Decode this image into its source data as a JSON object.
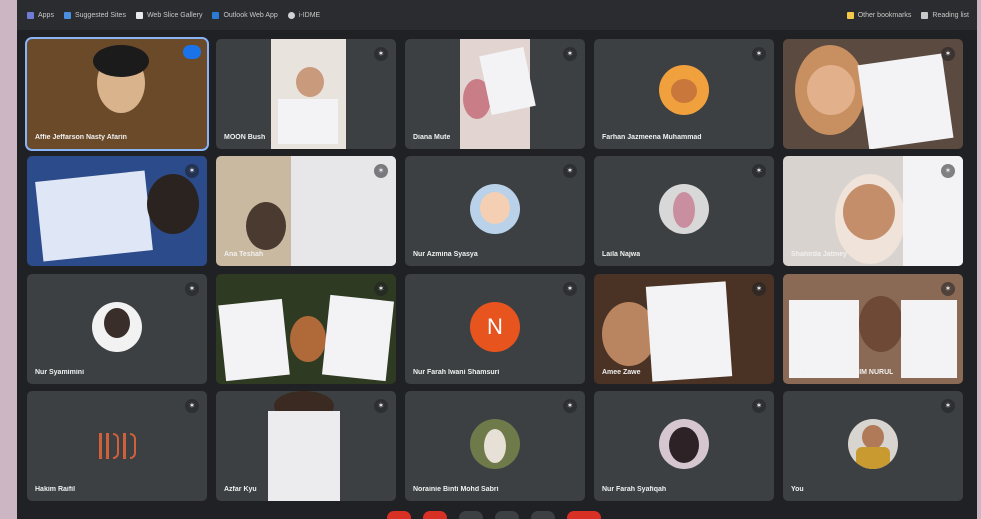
{
  "bookmarks": {
    "left": [
      "Apps",
      "Suggested Sites",
      "Web Slice Gallery",
      "Outlook Web App",
      "i-IDME"
    ],
    "right": [
      "Other bookmarks",
      "Reading list"
    ]
  },
  "participants": [
    {
      "name": "Affie Jeffarson Nasty Afarin",
      "avatar": "video"
    },
    {
      "name": "MOON Bush",
      "avatar": "video"
    },
    {
      "name": "Diana Mute",
      "avatar": "video"
    },
    {
      "name": "Farhan Jazmeena Muhammad",
      "avatar": "photo"
    },
    {
      "name": "",
      "avatar": "video"
    },
    {
      "name": "",
      "avatar": "video"
    },
    {
      "name": "Ana Teshah",
      "avatar": "video"
    },
    {
      "name": "Nur Azmina Syasya",
      "avatar": "photo"
    },
    {
      "name": "Laila Najwa",
      "avatar": "photo"
    },
    {
      "name": "Shahirda Jatmey",
      "avatar": "video"
    },
    {
      "name": "Nur Syamimini",
      "avatar": "photo"
    },
    {
      "name": "",
      "avatar": "video"
    },
    {
      "name": "Nur Farah Iwani Shamsuri",
      "avatar": "N"
    },
    {
      "name": "Amee Zawe",
      "avatar": "video"
    },
    {
      "name": "NUR SYAFINAZ KAEIM NURUL",
      "avatar": "video"
    },
    {
      "name": "Hakim Raifil",
      "avatar": "logo"
    },
    {
      "name": "Azfar Kyu",
      "avatar": "video"
    },
    {
      "name": "Norainie Binti Mohd Sabri",
      "avatar": "photo"
    },
    {
      "name": "Nur Farah Syafiqah",
      "avatar": "photo"
    },
    {
      "name": "You",
      "avatar": "photo"
    }
  ],
  "letter_avatar": "N",
  "colors": {
    "tile": "#3c4043",
    "background": "#202124",
    "accent": "#8ab4f8",
    "letter_avatar": "#e8541e"
  }
}
